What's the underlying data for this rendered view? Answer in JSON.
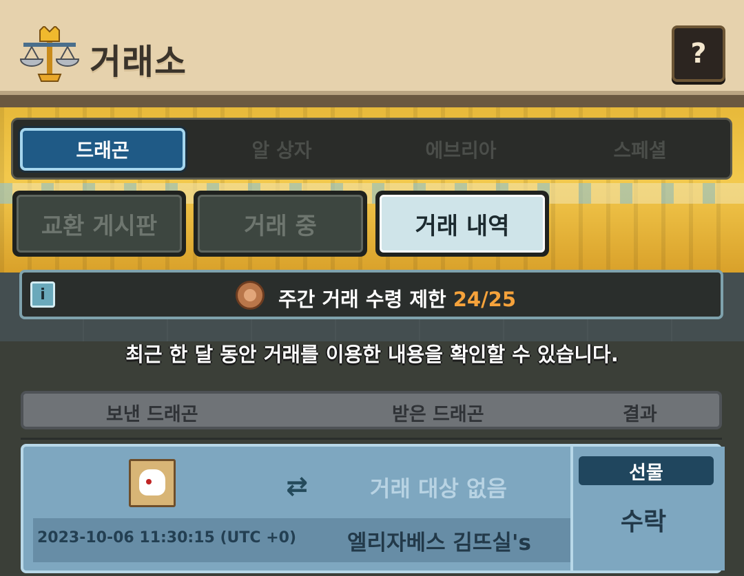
{
  "header": {
    "title": "거래소",
    "help_label": "?"
  },
  "category_tabs": [
    {
      "label": "드래곤",
      "active": true
    },
    {
      "label": "알 상자",
      "active": false
    },
    {
      "label": "에브리아",
      "active": false
    },
    {
      "label": "스페셜",
      "active": false
    }
  ],
  "sub_tabs": [
    {
      "label": "교환 게시판",
      "active": false
    },
    {
      "label": "거래 중",
      "active": false
    },
    {
      "label": "거래 내역",
      "active": true
    }
  ],
  "info_bar": {
    "icon_label": "i",
    "text": "주간 거래 수령 제한",
    "count": "24/25"
  },
  "description": "최근 한 달 동안 거래를 이용한 내용을 확인할 수 있습니다.",
  "table": {
    "headers": {
      "sent": "보낸 드래곤",
      "received": "받은 드래곤",
      "result": "결과"
    }
  },
  "record": {
    "received_text": "거래 대상 없음",
    "timestamp": "2023-10-06 11:30:15 (UTC +0)",
    "partner": "엘리자베스 김뜨실's",
    "type_badge": "선물",
    "result": "수락"
  },
  "icons": {
    "logo": "scale-trophy-icon",
    "swap": "swap-arrows-icon",
    "limit": "cat-coin-icon"
  },
  "colors": {
    "active_category": "#1f5a86",
    "count_highlight": "#f5a23b",
    "record_bg": "#7ea7c0"
  }
}
